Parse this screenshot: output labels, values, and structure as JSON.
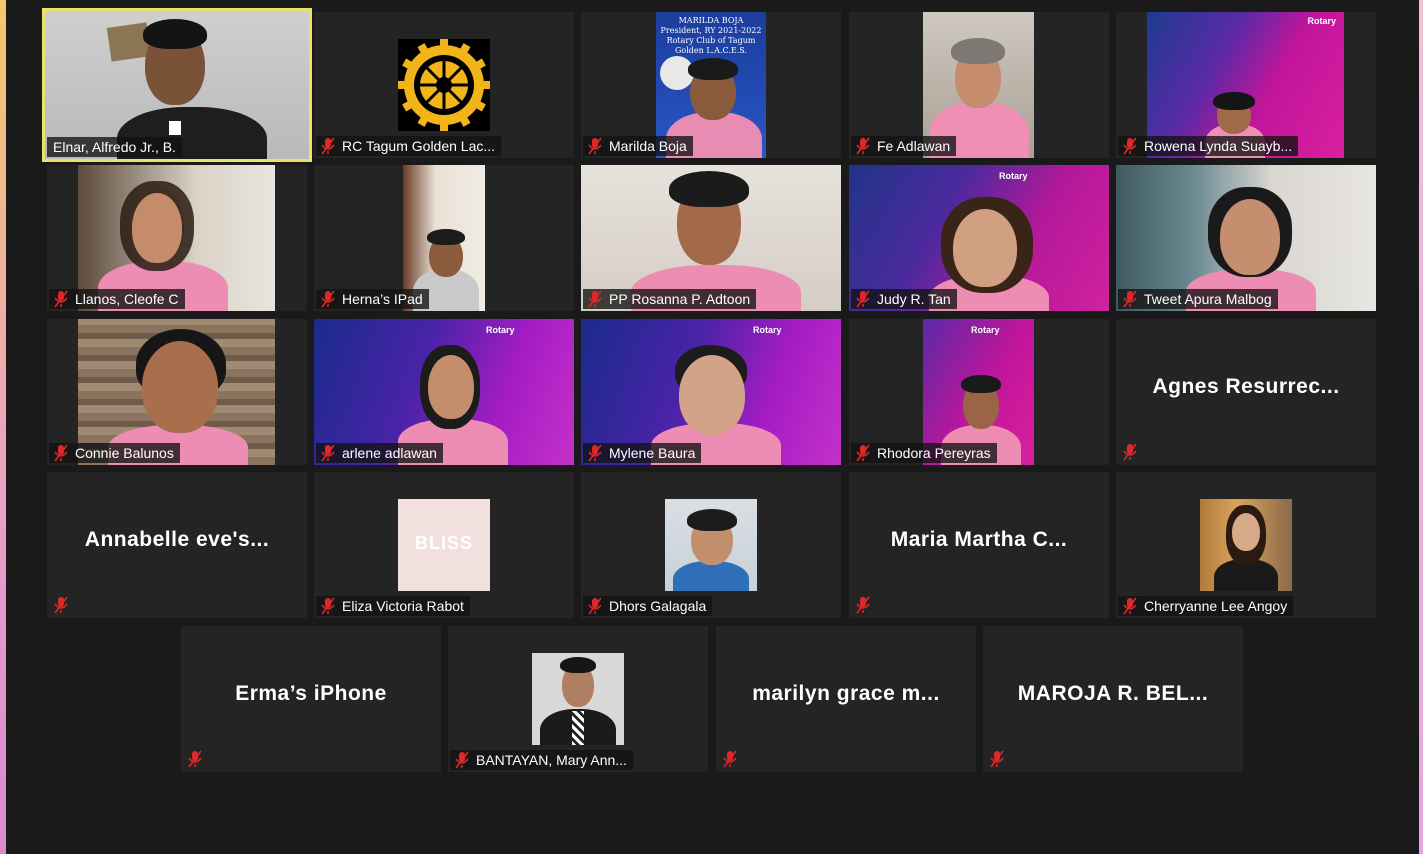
{
  "participants": [
    {
      "name": "Elnar, Alfredo Jr., B."
    },
    {
      "name": "RC Tagum Golden Lac..."
    },
    {
      "name": "Marilda Boja"
    },
    {
      "name": "Fe Adlawan"
    },
    {
      "name": "Rowena Lynda Suayb..."
    },
    {
      "name": "Llanos, Cleofe C"
    },
    {
      "name": "Herna’s IPad"
    },
    {
      "name": "PP Rosanna P. Adtoon"
    },
    {
      "name": "Judy R. Tan"
    },
    {
      "name": "Tweet Apura Malbog"
    },
    {
      "name": "Connie Balunos"
    },
    {
      "name": "arlene adlawan"
    },
    {
      "name": "Mylene Baura"
    },
    {
      "name": "Rhodora Pereyras"
    },
    {
      "name": "Agnes  Resurrec..."
    },
    {
      "name": "Annabelle  eve's..."
    },
    {
      "name": "Eliza Victoria Rabot"
    },
    {
      "name": "Dhors Galagala"
    },
    {
      "name": "Maria  Martha  C..."
    },
    {
      "name": "Cherryanne Lee Angoy"
    },
    {
      "name": "Erma’s iPhone"
    },
    {
      "name": "BANTAYAN, Mary Ann..."
    },
    {
      "name": "marilyn  grace  m..."
    },
    {
      "name": "MAROJA  R.  BEL..."
    }
  ],
  "rotary_logo_text": "ROTARY INTERNATIONAL",
  "marilda_banner": {
    "line1": "MARILDA BOJA",
    "line2": "President, RY 2021-2022",
    "line3": "Rotary Club of Tagum Golden L.A.C.E.S."
  },
  "bg_brand": "Rotary",
  "bliss_text": "BLISS",
  "colors": {
    "active_border": "#e8e36a",
    "mute_red": "#e02828",
    "tile_bg": "#242424"
  },
  "icons": {
    "muted": "mic-muted-icon"
  }
}
